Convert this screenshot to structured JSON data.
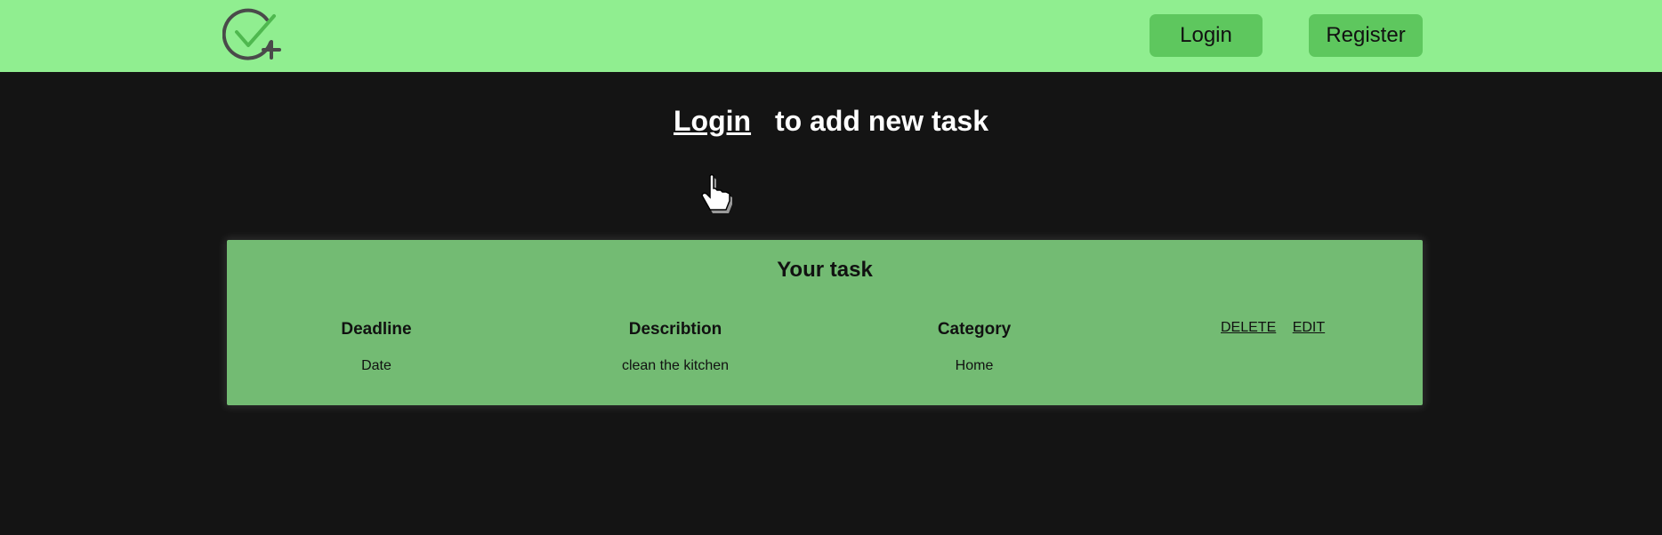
{
  "header": {
    "logo_icon": "check-plus-icon",
    "login_label": "Login",
    "register_label": "Register",
    "colors": {
      "background": "#90ee90",
      "button": "#5ec75e"
    }
  },
  "prompt": {
    "link_label": "Login",
    "text": "to add new task"
  },
  "task_card": {
    "title": "Your task",
    "columns": [
      "Deadline",
      "Describtion",
      "Category"
    ],
    "rows": [
      {
        "deadline": "Date",
        "description": "clean the kitchen",
        "category": "Home"
      }
    ],
    "actions": {
      "delete_label": "DELETE",
      "edit_label": "EDIT"
    },
    "color": "#73bb73"
  },
  "cursor_icon": "hand-pointer-icon"
}
